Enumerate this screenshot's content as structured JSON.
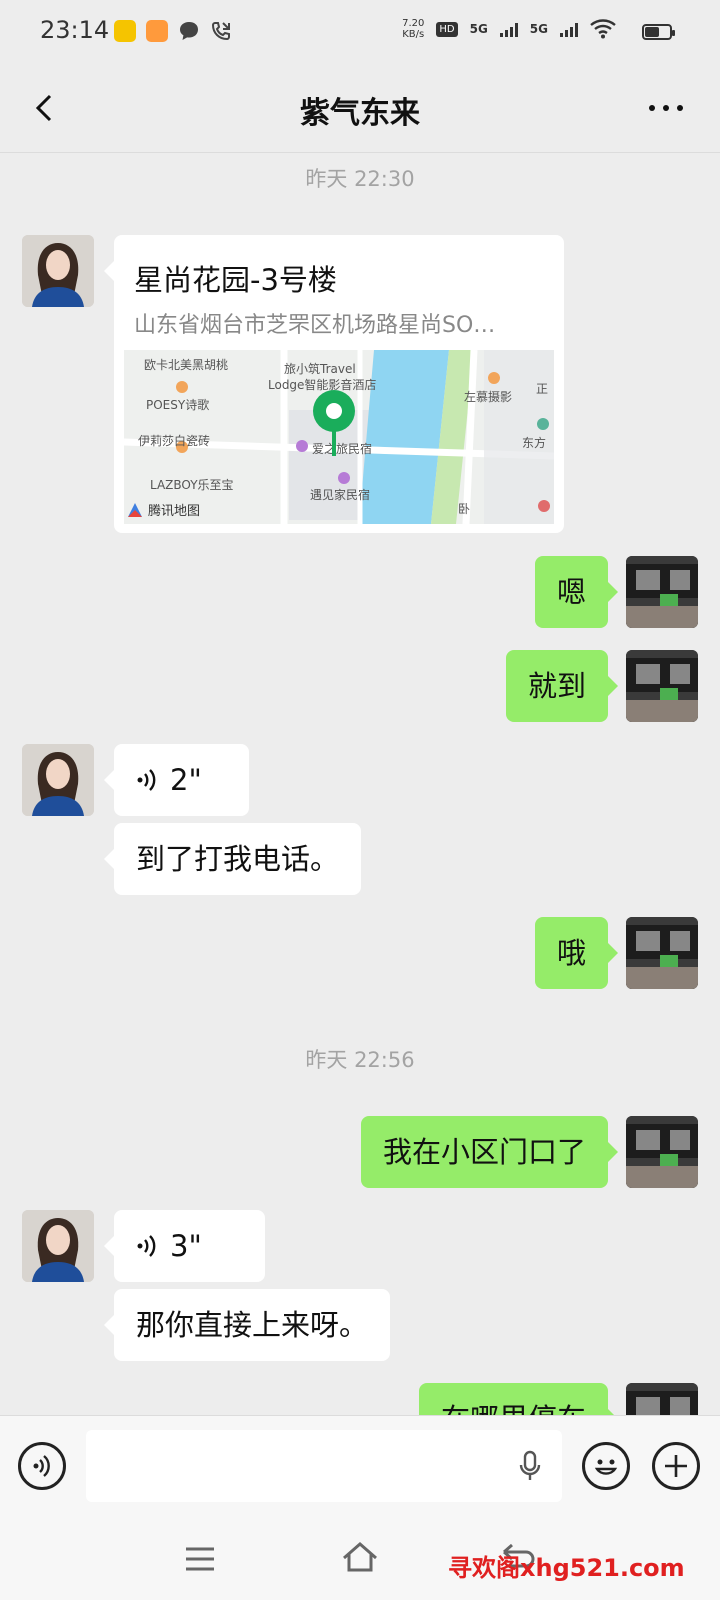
{
  "status_bar": {
    "time": "23:14",
    "net_speed_value": "7.20",
    "net_speed_unit": "KB/s",
    "hd_badge": "HD",
    "sim1": "5G",
    "sim2": "5G",
    "battery_level": 0.6
  },
  "header": {
    "title": "紫气东来"
  },
  "timestamps": [
    "昨天 22:30",
    "昨天 22:56"
  ],
  "location": {
    "name": "星尚花园-3号楼",
    "address": "山东省烟台市芝罘区机场路星尚SO…",
    "map_labels": [
      "欧卡北美黑胡桃",
      "POESY诗歌",
      "伊莉莎白瓷砖",
      "LAZBOY乐至宝",
      "旅小筑Travel",
      "Lodge智能影音酒店",
      "爱之旅民宿",
      "遇见家民宿",
      "左慕摄影",
      "东方",
      "正",
      "卧"
    ],
    "map_brand": "腾讯地图"
  },
  "messages": [
    {
      "side": "out",
      "text": "嗯"
    },
    {
      "side": "out",
      "text": "就到"
    },
    {
      "side": "in",
      "voice_duration": "2\""
    },
    {
      "side": "in",
      "text": "到了打我电话。"
    },
    {
      "side": "out",
      "text": "哦"
    },
    {
      "side": "out",
      "text": "我在小区门口了"
    },
    {
      "side": "in",
      "voice_duration": "3\""
    },
    {
      "side": "in",
      "text": "那你直接上来呀。"
    },
    {
      "side": "out",
      "text": "在哪里停车"
    }
  ],
  "watermark": "寻欢阁xhg521.com",
  "colors": {
    "outgoing_bubble": "#95ec69",
    "incoming_bubble": "#ffffff",
    "background": "#ededed",
    "map_pin": "#1aad5b"
  }
}
